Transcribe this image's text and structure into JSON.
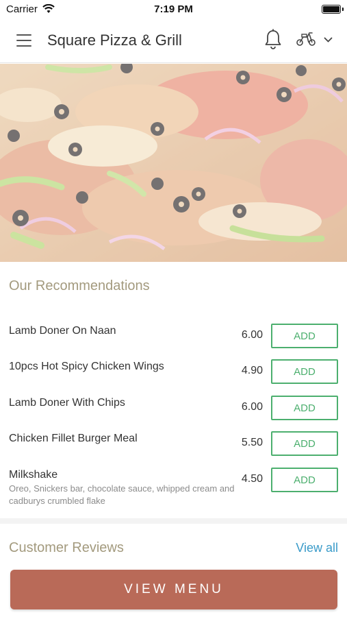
{
  "status_bar": {
    "carrier": "Carrier",
    "time": "7:19 PM",
    "icons": [
      "wifi-icon",
      "battery-icon"
    ]
  },
  "header": {
    "title": "Square Pizza & Grill",
    "icons": [
      "menu-icon",
      "bell-icon",
      "scooter-icon",
      "chevron-down-icon"
    ]
  },
  "hero": {
    "image": "pizza-photo"
  },
  "recommendations": {
    "title": "Our Recommendations",
    "items": [
      {
        "name": "Lamb Doner On Naan",
        "description": "",
        "price": "6.00",
        "button": "ADD"
      },
      {
        "name": "10pcs Hot Spicy Chicken Wings",
        "description": "",
        "price": "4.90",
        "button": "ADD"
      },
      {
        "name": "Lamb Doner With Chips",
        "description": "",
        "price": "6.00",
        "button": "ADD"
      },
      {
        "name": "Chicken Fillet Burger Meal",
        "description": "",
        "price": "5.50",
        "button": "ADD"
      },
      {
        "name": "Milkshake",
        "description": "Oreo, Snickers bar, chocolate sauce, whipped cream and cadburys crumbled flake",
        "price": "4.50",
        "button": "ADD"
      }
    ]
  },
  "reviews": {
    "title": "Customer Reviews",
    "view_all": "View all"
  },
  "footer": {
    "view_menu": "VIEW MENU"
  },
  "colors": {
    "accent_green": "#4caf6e",
    "section_title": "#a39a7e",
    "link_blue": "#3a9bc9",
    "primary_button": "#b96a58"
  }
}
